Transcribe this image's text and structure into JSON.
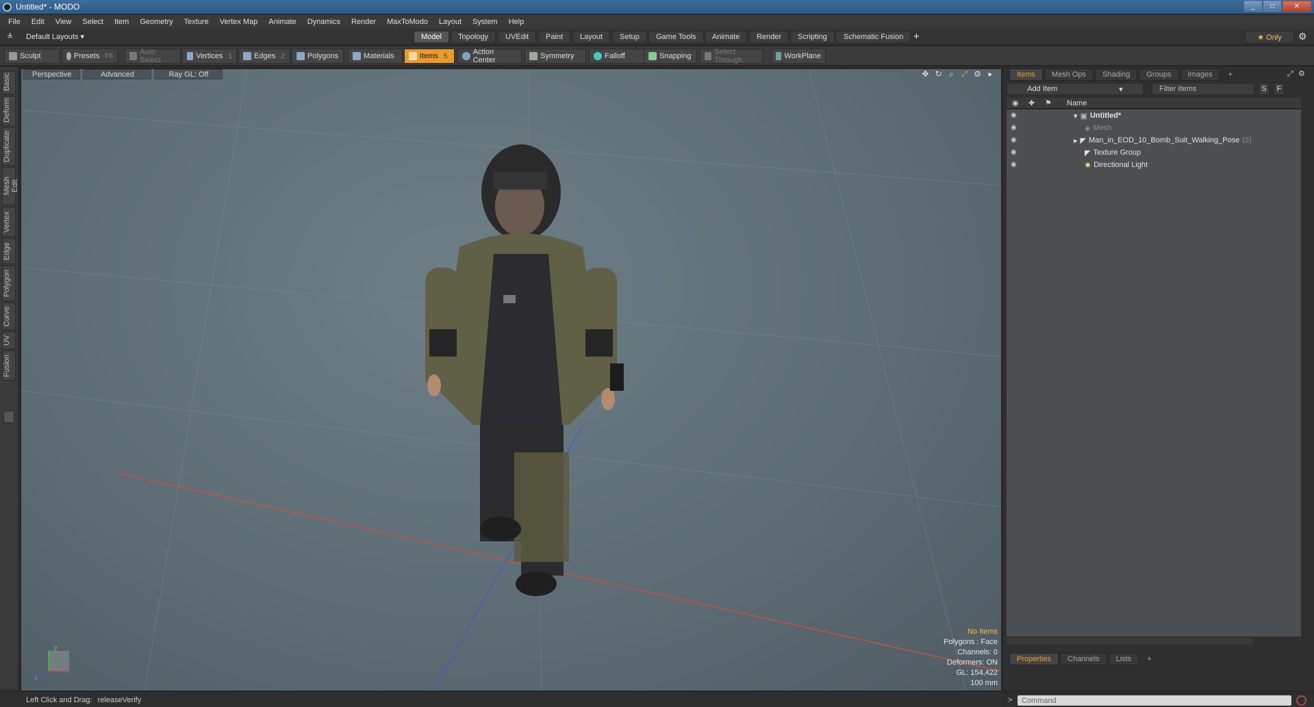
{
  "window": {
    "title": "Untitled* - MODO",
    "minimize": "_",
    "maximize": "□",
    "close": "✕"
  },
  "menu": [
    "File",
    "Edit",
    "View",
    "Select",
    "Item",
    "Geometry",
    "Texture",
    "Vertex Map",
    "Animate",
    "Dynamics",
    "Render",
    "MaxToModo",
    "Layout",
    "System",
    "Help"
  ],
  "layouts": {
    "dropdown": "Default Layouts ▾",
    "tabs": [
      "Model",
      "Topology",
      "UVEdit",
      "Paint",
      "Layout",
      "Setup",
      "Game Tools",
      "Animate",
      "Render",
      "Scripting",
      "Schematic Fusion"
    ],
    "active": "Model",
    "add": "+",
    "only": "★ Only",
    "gear": "⚙"
  },
  "toolbar": {
    "sculpt": "Sculpt",
    "presets": "Presets",
    "presets_key": "F6",
    "auto_select": "Auto Select",
    "vertices": "Vertices",
    "vertices_key": "1",
    "edges": "Edges",
    "edges_key": "2",
    "polygons": "Polygons",
    "materials": "Materials",
    "items": "Items",
    "items_key": "5",
    "action_center": "Action Center",
    "symmetry": "Symmetry",
    "falloff": "Falloff",
    "snapping": "Snapping",
    "select_through": "Select Through",
    "workplane": "WorkPlane"
  },
  "left_tabs": [
    "Basic",
    "Deform",
    "Duplicate",
    "Mesh Edit",
    "Vertex",
    "Edge",
    "Polygon",
    "Curve",
    "UV",
    "Fusion"
  ],
  "viewport": {
    "perspective": "Perspective",
    "advanced": "Advanced",
    "raygl": "Ray GL: Off",
    "stats": {
      "items": "No Items",
      "polygons": "Polygons : Face",
      "channels": "Channels: 0",
      "deformers": "Deformers: ON",
      "gl": "GL: 154,422",
      "scale": "100 mm"
    },
    "axis_y": "y",
    "axis_z": "z"
  },
  "items_panel": {
    "tabs": [
      "Items",
      "Mesh Ops",
      "Shading",
      "Groups",
      "Images",
      "+"
    ],
    "active_tab": "Items",
    "add_item": "Add Item",
    "filter": "Filter Items",
    "s_btn": "S",
    "f_btn": "F",
    "column_name": "Name",
    "rows": [
      {
        "name": "Untitled*",
        "bold": true
      },
      {
        "name": "Mesh",
        "dim": true
      },
      {
        "name": "Man_in_EOD_10_Bomb_Suit_Walking_Pose",
        "count": "(3)"
      },
      {
        "name": "Texture Group"
      },
      {
        "name": "Directional Light"
      }
    ]
  },
  "properties_panel": {
    "tabs": [
      "Properties",
      "Channels",
      "Lists",
      "+"
    ],
    "active_tab": "Properties"
  },
  "command": {
    "placeholder": "Command",
    "prompt": ">"
  },
  "status": {
    "hint": "Left Click and Drag:",
    "action": "releaseVerify"
  },
  "colors": {
    "accent": "#e89a2a",
    "viewport_bg": "#5c6b74",
    "x_axis": "#d0503a",
    "z_axis": "#4060c0"
  }
}
